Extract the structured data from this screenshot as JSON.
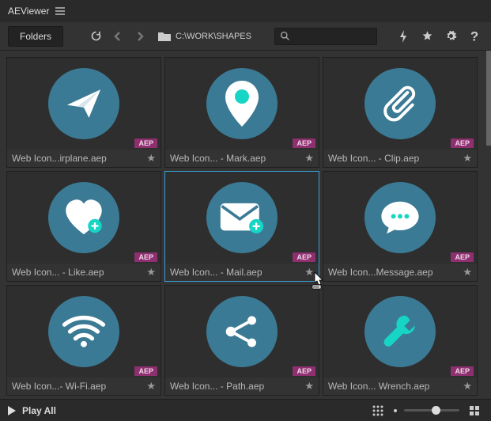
{
  "titlebar": {
    "app_name": "AEViewer"
  },
  "toolbar": {
    "folders_label": "Folders",
    "path": "C:\\WORK\\SHAPES",
    "search_placeholder": ""
  },
  "grid": {
    "badge": "AEP",
    "items": [
      {
        "label": "Web Icon...irplane.aep",
        "icon": "paper-plane",
        "selected": false
      },
      {
        "label": "Web Icon... - Mark.aep",
        "icon": "map-pin",
        "selected": false
      },
      {
        "label": "Web Icon... - Clip.aep",
        "icon": "paperclip",
        "selected": false
      },
      {
        "label": "Web Icon... - Like.aep",
        "icon": "heart-plus",
        "selected": false
      },
      {
        "label": "Web Icon... - Mail.aep",
        "icon": "mail-plus",
        "selected": true
      },
      {
        "label": "Web Icon...Message.aep",
        "icon": "chat",
        "selected": false
      },
      {
        "label": "Web Icon...- Wi-Fi.aep",
        "icon": "wifi",
        "selected": false
      },
      {
        "label": "Web Icon... - Path.aep",
        "icon": "share-nodes",
        "selected": false
      },
      {
        "label": "Web Icon... Wrench.aep",
        "icon": "wrench",
        "selected": false
      }
    ]
  },
  "footer": {
    "play_all": "Play All"
  },
  "colors": {
    "circle": "#3b7a94",
    "badge": "#8e3070",
    "accent": "#17d5c4"
  }
}
